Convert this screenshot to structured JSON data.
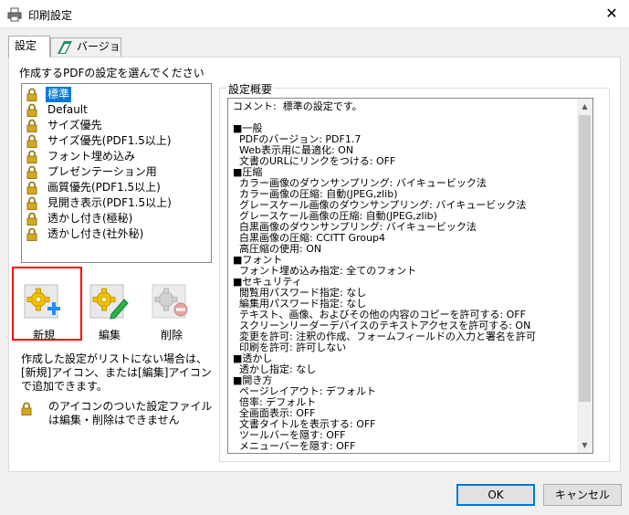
{
  "window": {
    "title": "印刷設定",
    "close_glyph": "✕"
  },
  "tabs": [
    {
      "label": "設定",
      "active": true
    },
    {
      "label": "バージョン",
      "active": false
    }
  ],
  "settings_list": {
    "prompt": "作成するPDFの設定を選んでください",
    "selected_index": 0,
    "items": [
      "標準",
      "Default",
      "サイズ優先",
      "サイズ優先(PDF1.5以上)",
      "フォント埋め込み",
      "プレゼンテーション用",
      "画質優先(PDF1.5以上)",
      "見開き表示(PDF1.5以上)",
      "透かし付き(極秘)",
      "透かし付き(社外秘)"
    ]
  },
  "actions": {
    "new_label": "新規",
    "edit_label": "編集",
    "delete_label": "削除"
  },
  "help": {
    "text": "作成した設定がリストにない場合は、[新規]アイコン、または[編集]アイコンで追加できます。",
    "note": "のアイコンのついた設定ファイルは編集・削除はできません"
  },
  "summary": {
    "label": "設定概要",
    "lines": [
      "コメント:  標準の設定です。",
      "",
      "■一般",
      "  PDFのバージョン: PDF1.7",
      "  Web表示用に最適化: ON",
      "  文書のURLにリンクをつける: OFF",
      "■圧縮",
      "  カラー画像のダウンサンプリング: バイキュービック法",
      "  カラー画像の圧縮: 自動(JPEG,zlib)",
      "  グレースケール画像のダウンサンプリング: バイキュービック法",
      "  グレースケール画像の圧縮: 自動(JPEG,zlib)",
      "  白黒画像のダウンサンプリング: バイキュービック法",
      "  白黒画像の圧縮: CCITT Group4",
      "  高圧縮の使用: ON",
      "■フォント",
      "  フォント埋め込み指定: 全てのフォント",
      "■セキュリティ",
      "  閲覧用パスワード指定: なし",
      "  編集用パスワード指定: なし",
      "  テキスト、画像、およびその他の内容のコピーを許可する: OFF",
      "  スクリーンリーダーデバイスのテキストアクセスを許可する: ON",
      "  変更を許可: 注釈の作成、フォームフィールドの入力と署名を許可",
      "  印刷を許可: 許可しない",
      "■透かし",
      "  透かし指定: なし",
      "■開き方",
      "  ページレイアウト: デフォルト",
      "  倍率: デフォルト",
      "  全画面表示: OFF",
      "  文書タイトルを表示する: OFF",
      "  ツールバーを隠す: OFF",
      "  メニューバーを隠す: OFF"
    ]
  },
  "buttons": {
    "ok": "OK",
    "cancel": "キャンセル"
  },
  "colors": {
    "selection": "#0078d7",
    "highlight_box": "#ff0000",
    "lock": "#c9a227"
  }
}
